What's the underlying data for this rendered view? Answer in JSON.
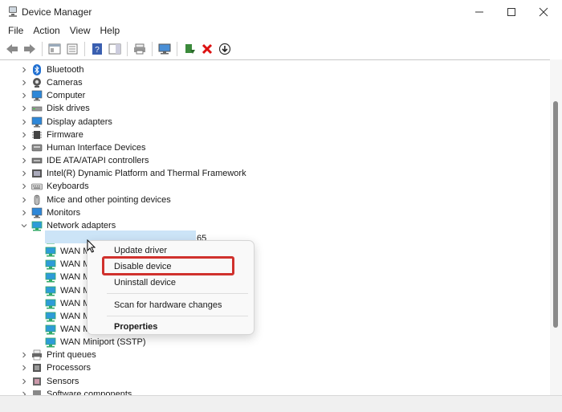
{
  "window": {
    "title": "Device Manager"
  },
  "menubar": [
    "File",
    "Action",
    "View",
    "Help"
  ],
  "tree": [
    {
      "label": "Bluetooth",
      "icon": "bluetooth-icon",
      "expanded": false
    },
    {
      "label": "Cameras",
      "icon": "camera-icon",
      "expanded": false
    },
    {
      "label": "Computer",
      "icon": "computer-icon",
      "expanded": false
    },
    {
      "label": "Disk drives",
      "icon": "disk-drive-icon",
      "expanded": false
    },
    {
      "label": "Display adapters",
      "icon": "display-adapter-icon",
      "expanded": false
    },
    {
      "label": "Firmware",
      "icon": "firmware-icon",
      "expanded": false
    },
    {
      "label": "Human Interface Devices",
      "icon": "hid-icon",
      "expanded": false
    },
    {
      "label": "IDE ATA/ATAPI controllers",
      "icon": "ide-controller-icon",
      "expanded": false
    },
    {
      "label": "Intel(R) Dynamic Platform and Thermal Framework",
      "icon": "thermal-framework-icon",
      "expanded": false
    },
    {
      "label": "Keyboards",
      "icon": "keyboard-icon",
      "expanded": false
    },
    {
      "label": "Mice and other pointing devices",
      "icon": "mouse-icon",
      "expanded": false
    },
    {
      "label": "Monitors",
      "icon": "monitor-icon",
      "expanded": false
    },
    {
      "label": "Network adapters",
      "icon": "network-adapter-icon",
      "expanded": true
    }
  ],
  "network_children": [
    "Intel(R) Dual Band Wireless-AC 3165",
    "WAN M",
    "WAN M",
    "WAN M",
    "WAN M",
    "WAN M",
    "WAN M",
    "WAN M",
    "WAN Miniport (SSTP)"
  ],
  "tree_after": [
    {
      "label": "Print queues",
      "icon": "printer-icon"
    },
    {
      "label": "Processors",
      "icon": "processor-icon"
    },
    {
      "label": "Sensors",
      "icon": "sensor-icon"
    },
    {
      "label": "Software components",
      "icon": "software-component-icon"
    }
  ],
  "context_menu": {
    "update_driver": "Update driver",
    "disable_device": "Disable device",
    "uninstall_device": "Uninstall device",
    "scan_hardware": "Scan for hardware changes",
    "properties": "Properties"
  },
  "colors": {
    "highlight_box": "#d0312d",
    "selected_row": "#cce4f7",
    "icon_blue": "#2a7fd4"
  }
}
